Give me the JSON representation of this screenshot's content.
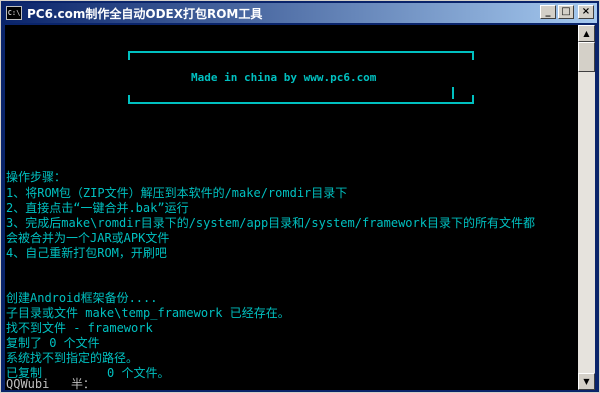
{
  "window": {
    "title": "PC6.com制作全自动ODEX打包ROM工具",
    "icon_text": "C:\\",
    "buttons": {
      "minimize": "_",
      "maximize": "□",
      "close": "×"
    }
  },
  "banner": {
    "text": "Made in china by www.pc6.com"
  },
  "console_lines": [
    "操作步骤：",
    "1、将ROM包（ZIP文件）解压到本软件的/make/romdir目录下",
    "2、直接点击“一键合并.bak”运行",
    "3、完成后make\\romdir目录下的/system/app目录和/system/framework目录下的所有文件都",
    "会被合并为一个JAR或APK文件",
    "4、自己重新打包ROM，开刷吧",
    "创建Android框架备份....",
    "子目录或文件 make\\temp_framework 已经存在。",
    "找不到文件 - framework",
    "复制了 0 个文件",
    "系统找不到指定的路径。",
    "已复制         0 个文件。",
    "QQWubi   半："
  ],
  "scrollbar": {
    "up": "▲",
    "down": "▼"
  }
}
